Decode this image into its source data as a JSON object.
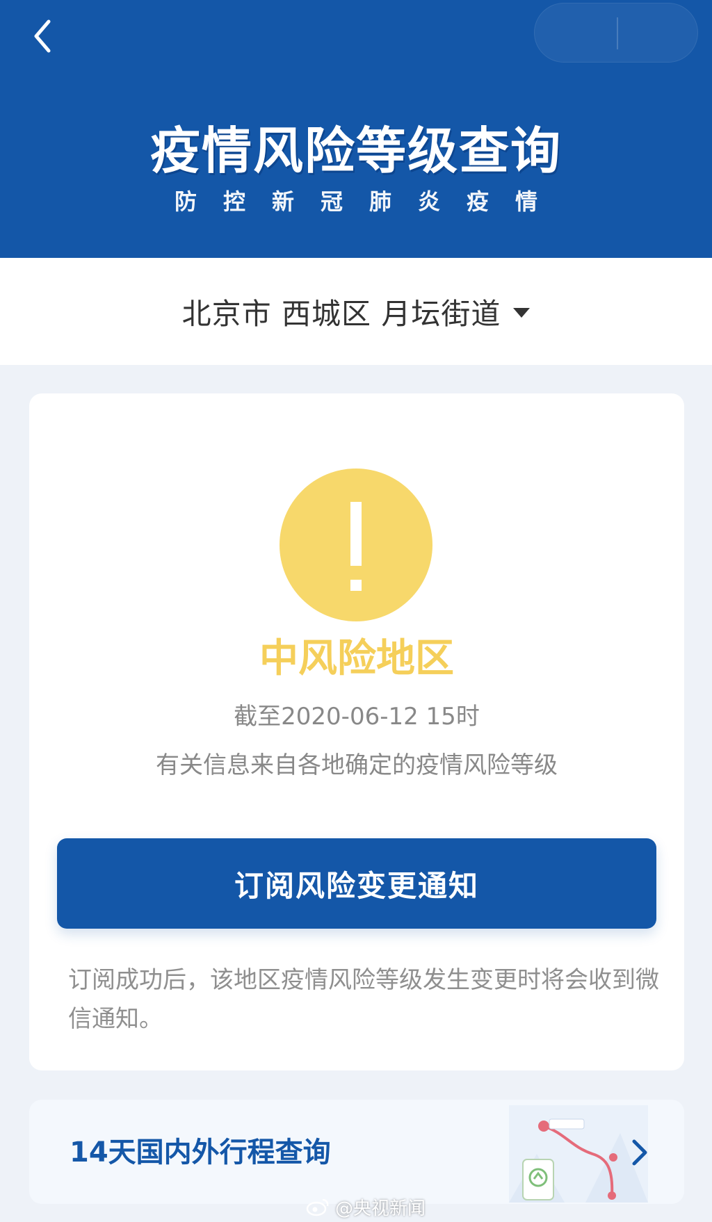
{
  "header": {
    "back_icon": "chevron-left-icon",
    "title": "疫情风险等级查询",
    "subtitle": "防控新冠肺炎疫情"
  },
  "location": {
    "text": "北京市 西城区 月坛街道",
    "dropdown_icon": "caret-down-icon"
  },
  "risk": {
    "icon": "exclamation-icon",
    "level": "中风险地区",
    "date": "截至2020-06-12 15时",
    "source": "有关信息来自各地确定的疫情风险等级",
    "color": "#f7d86b"
  },
  "subscribe": {
    "label": "订阅风险变更通知",
    "note": "订阅成功后，该地区疫情风险等级发生变更时将会收到微信通知。"
  },
  "itinerary": {
    "label": "14天国内外行程查询",
    "icon": "chevron-right-icon"
  },
  "watermark": {
    "text": "@央视新闻"
  },
  "colors": {
    "primary": "#1457a8",
    "risk_medium": "#f7d86b",
    "background": "#eef2f8"
  }
}
